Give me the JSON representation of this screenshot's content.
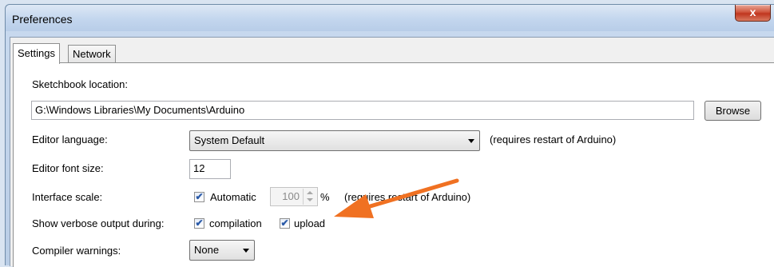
{
  "window": {
    "title": "Preferences",
    "close_label": "x"
  },
  "tabs": [
    {
      "label": "Settings",
      "active": true
    },
    {
      "label": "Network",
      "active": false
    }
  ],
  "settings": {
    "sketchbook": {
      "label": "Sketchbook location:",
      "value": "G:\\Windows Libraries\\My Documents\\Arduino",
      "browse_label": "Browse"
    },
    "editor_language": {
      "label": "Editor language:",
      "selected": "System Default",
      "note": "(requires restart of Arduino)"
    },
    "editor_font_size": {
      "label": "Editor font size:",
      "value": "12"
    },
    "interface_scale": {
      "label": "Interface scale:",
      "automatic_label": "Automatic",
      "automatic_checked": true,
      "value": "100",
      "unit": "%",
      "note": "(requires restart of Arduino)"
    },
    "verbose_output": {
      "label": "Show verbose output during:",
      "compilation_label": "compilation",
      "compilation_checked": true,
      "upload_label": "upload",
      "upload_checked": true
    },
    "compiler_warnings": {
      "label": "Compiler warnings:",
      "selected": "None"
    }
  },
  "colors": {
    "annotation_arrow": "#f07122",
    "close_button": "#c9452c"
  },
  "icons": {
    "checkbox_check": "✔"
  }
}
